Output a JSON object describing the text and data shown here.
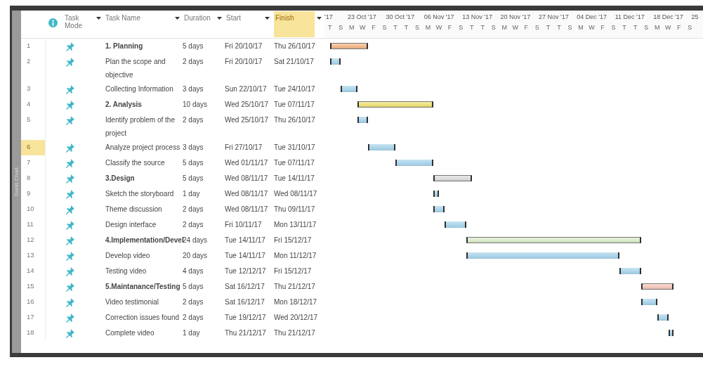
{
  "sidebar": {
    "label": "Gantt Chart"
  },
  "columns": [
    {
      "kind": "info"
    },
    {
      "kind": "mode",
      "label": "Task Mode",
      "selected": false
    },
    {
      "kind": "name",
      "label": "Task Name",
      "selected": false
    },
    {
      "kind": "duration",
      "label": "Duration",
      "selected": false
    },
    {
      "kind": "start",
      "label": "Start",
      "selected": false
    },
    {
      "kind": "finish",
      "label": "Finish",
      "selected": true
    }
  ],
  "timescale": {
    "weeks": [
      "'17",
      "23 Oct '17",
      "30 Oct '17",
      "06 Nov '17",
      "13 Nov '17",
      "20 Nov '17",
      "27 Nov '17",
      "04 Dec '17",
      "11 Dec '17",
      "18 Dec '17",
      "25"
    ],
    "days": [
      "T",
      "S",
      "M",
      "W",
      "F",
      "S",
      "T",
      "T",
      "S",
      "M",
      "W",
      "F",
      "S",
      "T",
      "T",
      "S",
      "M",
      "W",
      "F",
      "S",
      "T",
      "T",
      "S",
      "M",
      "W",
      "F",
      "S",
      "T",
      "T",
      "S",
      "M",
      "W",
      "F",
      "S"
    ]
  },
  "tasks": [
    {
      "id": "1",
      "kind": "summary",
      "selected": false,
      "name": "1. Planning",
      "duration": "5 days",
      "start": "Fri 20/10/17",
      "finish": "Thu 26/10/17",
      "color": "#f2b88a"
    },
    {
      "id": "2",
      "kind": "task",
      "selected": false,
      "name": "Plan the scope and objective",
      "duration": "2 days",
      "start": "Fri 20/10/17",
      "finish": "Sat 21/10/17",
      "color": "#a9d4ea"
    },
    {
      "id": "3",
      "kind": "task",
      "selected": false,
      "name": "Collecting Information",
      "duration": "3 days",
      "start": "Sun 22/10/17",
      "finish": "Tue 24/10/17",
      "color": "#a9d4ea"
    },
    {
      "id": "4",
      "kind": "summary",
      "selected": false,
      "name": "2. Analysis",
      "duration": "10 days",
      "start": "Wed 25/10/17",
      "finish": "Tue 07/11/17",
      "color": "#eee27a"
    },
    {
      "id": "5",
      "kind": "task",
      "selected": false,
      "name": "Identify problem of the project",
      "duration": "2 days",
      "start": "Wed 25/10/17",
      "finish": "Thu 26/10/17",
      "color": "#a9d4ea"
    },
    {
      "id": "6",
      "kind": "task",
      "selected": true,
      "name": "Analyze project process",
      "duration": "3 days",
      "start": "Fri 27/10/17",
      "finish": "Tue 31/10/17",
      "color": "#a9d4ea"
    },
    {
      "id": "7",
      "kind": "task",
      "selected": false,
      "name": "Classify the source",
      "duration": "5 days",
      "start": "Wed 01/11/17",
      "finish": "Tue 07/11/17",
      "color": "#a9d4ea"
    },
    {
      "id": "8",
      "kind": "summary",
      "selected": false,
      "name": "3.Design",
      "duration": "5 days",
      "start": "Wed 08/11/17",
      "finish": "Tue 14/11/17",
      "color": "#dcdcdc"
    },
    {
      "id": "9",
      "kind": "task",
      "selected": false,
      "name": "Sketch the storyboard",
      "duration": "1 day",
      "start": "Wed 08/11/17",
      "finish": "Wed 08/11/17",
      "color": "#a9d4ea"
    },
    {
      "id": "10",
      "kind": "task",
      "selected": false,
      "name": "Theme discussion",
      "duration": "2 days",
      "start": "Wed 08/11/17",
      "finish": "Thu 09/11/17",
      "color": "#a9d4ea"
    },
    {
      "id": "11",
      "kind": "task",
      "selected": false,
      "name": "Design interface",
      "duration": "2 days",
      "start": "Fri 10/11/17",
      "finish": "Mon 13/11/17",
      "color": "#a9d4ea"
    },
    {
      "id": "12",
      "kind": "summary",
      "selected": false,
      "name": "4.Implementation/Devel",
      "duration": "24 days",
      "start": "Tue 14/11/17",
      "finish": "Fri 15/12/17",
      "color": "#d9ebc9"
    },
    {
      "id": "13",
      "kind": "task",
      "selected": false,
      "name": "Develop video",
      "duration": "20 days",
      "start": "Tue 14/11/17",
      "finish": "Mon 11/12/17",
      "color": "#a9d4ea"
    },
    {
      "id": "14",
      "kind": "task",
      "selected": false,
      "name": "Testing video",
      "duration": "4 days",
      "start": "Tue 12/12/17",
      "finish": "Fri 15/12/17",
      "color": "#a9d4ea"
    },
    {
      "id": "15",
      "kind": "summary",
      "selected": false,
      "name": "5.Maintanance/Testing",
      "duration": "5 days",
      "start": "Sat 16/12/17",
      "finish": "Thu 21/12/17",
      "color": "#f4c8bc"
    },
    {
      "id": "16",
      "kind": "task",
      "selected": false,
      "name": "Video testimonial",
      "duration": "2 days",
      "start": "Sat 16/12/17",
      "finish": "Mon 18/12/17",
      "color": "#a9d4ea"
    },
    {
      "id": "17",
      "kind": "task",
      "selected": false,
      "name": "Correction issues found",
      "duration": "2 days",
      "start": "Tue 19/12/17",
      "finish": "Wed 20/12/17",
      "color": "#a9d4ea"
    },
    {
      "id": "18",
      "kind": "task",
      "selected": false,
      "name": "Complete video",
      "duration": "1 day",
      "start": "Thu 21/12/17",
      "finish": "Thu 21/12/17",
      "color": "#a9d4ea"
    }
  ]
}
